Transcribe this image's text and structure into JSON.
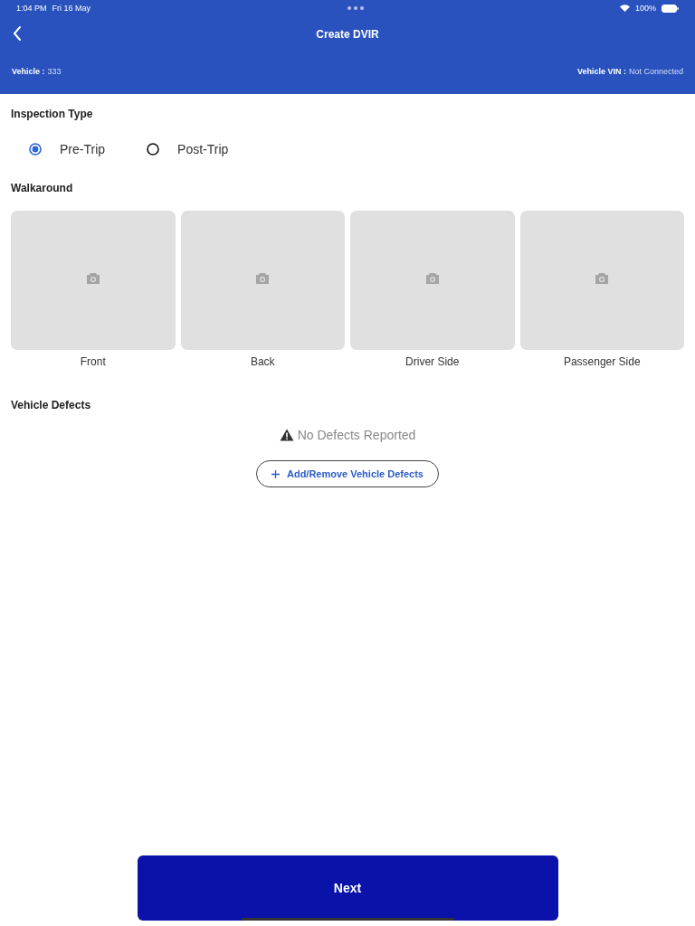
{
  "status_bar": {
    "time": "1:04 PM",
    "date": "Fri 16 May",
    "battery": "100%"
  },
  "header": {
    "title": "Create DVIR",
    "vehicle_label": "Vehicle :",
    "vehicle_value": "333",
    "vin_label": "Vehicle VIN :",
    "vin_value": "Not Connected"
  },
  "inspection_type": {
    "title": "Inspection Type",
    "options": [
      {
        "label": "Pre-Trip",
        "selected": true
      },
      {
        "label": "Post-Trip",
        "selected": false
      }
    ]
  },
  "walkaround": {
    "title": "Walkaround",
    "photos": [
      {
        "label": "Front"
      },
      {
        "label": "Back"
      },
      {
        "label": "Driver Side"
      },
      {
        "label": "Passenger Side"
      }
    ]
  },
  "vehicle_defects": {
    "title": "Vehicle Defects",
    "empty_message": "No Defects Reported",
    "button": "Add/Remove Vehicle Defects"
  },
  "next_button": "Next"
}
